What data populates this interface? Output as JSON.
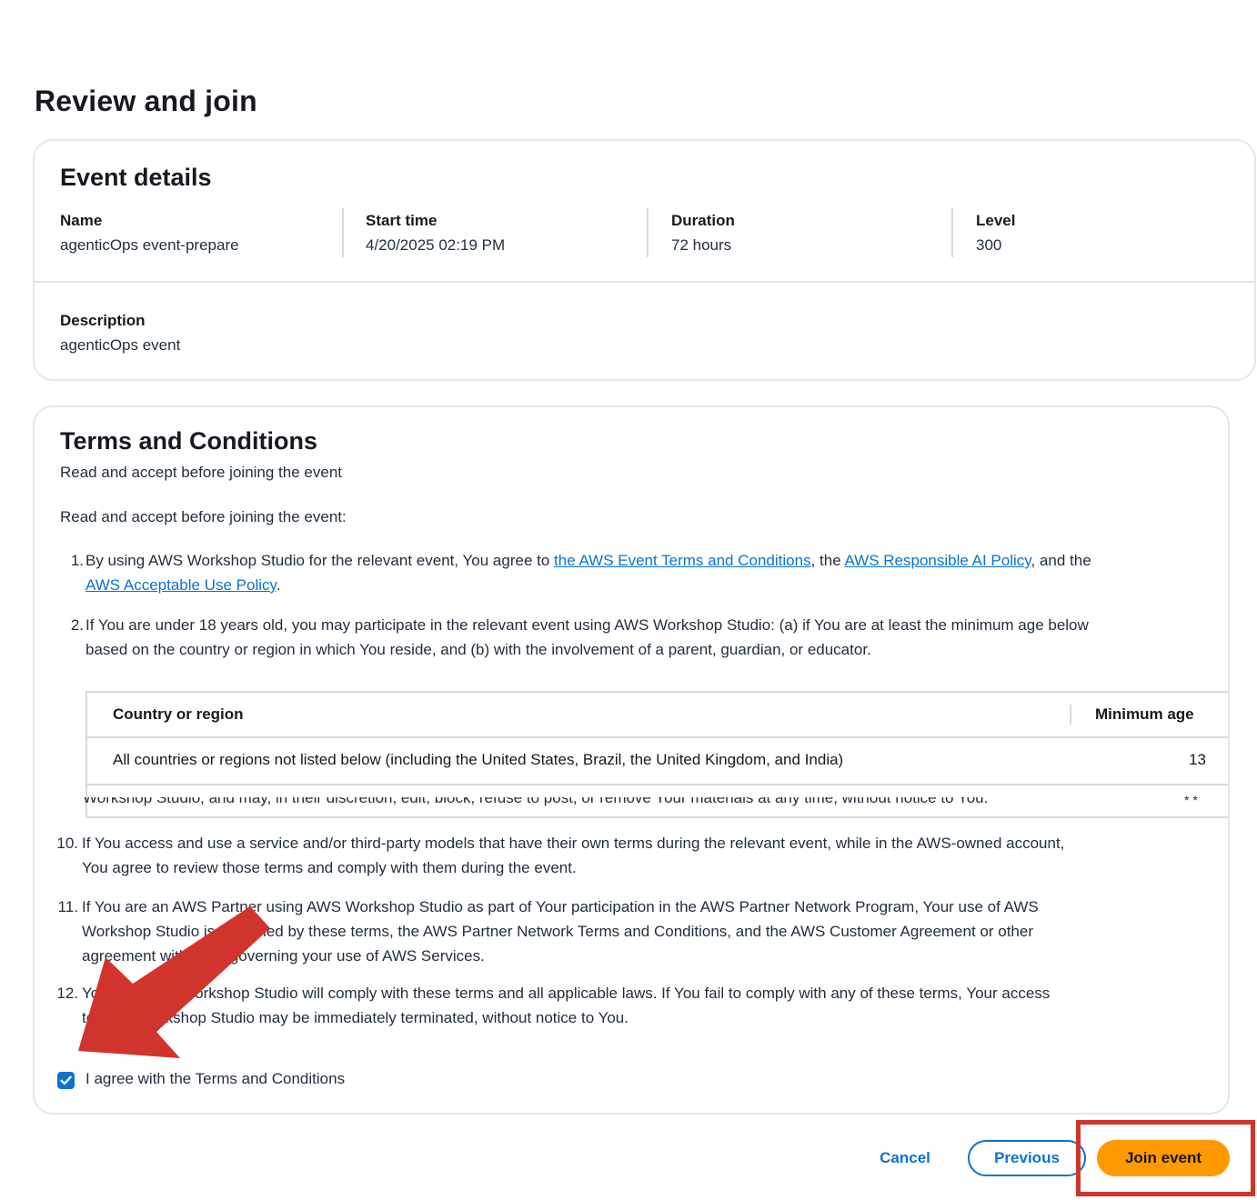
{
  "page": {
    "title": "Review and join"
  },
  "event_details": {
    "title": "Event details",
    "name_label": "Name",
    "name_value": "agenticOps event-prepare",
    "start_label": "Start time",
    "start_value": "4/20/2025 02:19 PM",
    "duration_label": "Duration",
    "duration_value": "72 hours",
    "level_label": "Level",
    "level_value": "300",
    "description_label": "Description",
    "description_value": "agenticOps event"
  },
  "terms": {
    "title": "Terms and Conditions",
    "subtitle": "Read and accept before joining the event",
    "intro": "Read and accept before joining the event:",
    "item1": {
      "number": "1.",
      "text_a": "By using AWS Workshop Studio for the relevant event, You agree to ",
      "link_a": "the AWS Event Terms and Conditions",
      "text_b": ", the ",
      "link_b": "AWS Responsible AI Policy",
      "text_c": ", and the",
      "link_c": "AWS Acceptable Use Policy",
      "text_d": "."
    },
    "item2": {
      "number": "2.",
      "line1": "If You are under 18 years old, you may participate in the relevant event using AWS Workshop Studio: (a) if You are at least the minimum age below",
      "line2": "based on the country or region in which You reside, and (b) with the involvement of a parent, guardian, or educator."
    },
    "age_table": {
      "col_country": "Country or region",
      "col_age": "Minimum age",
      "rows": [
        {
          "country": "All countries or regions not listed below (including the United States, Brazil, the United Kingdom, and India)",
          "age": "13"
        }
      ]
    },
    "clipped_line": "Workshop Studio, and may, in their discretion, edit, block, refuse to post, or remove Your materials at any time, without notice to You.",
    "clipped_right": "* *",
    "item10": {
      "number": "10.",
      "line1": "If You access and use a service and/or third-party models that have their own terms during the relevant event, while in the AWS-owned account,",
      "line2": "You agree to review those terms and comply with them during the event."
    },
    "item11": {
      "number": "11.",
      "line1": "If You are an AWS Partner using AWS Workshop Studio as part of Your participation in the AWS Partner Network Program, Your use of AWS",
      "line2": "Workshop Studio is governed by these terms, the AWS Partner Network Terms and Conditions, and the AWS Customer Agreement or other",
      "line3": "agreement with AWS governing your use of AWS Services."
    },
    "item12": {
      "number": "12.",
      "line1": "You and AWS Workshop Studio will comply with these terms and all applicable laws. If You fail to comply with any of these terms, Your access",
      "line2": "to AWS Workshop Studio may be immediately terminated, without notice to You."
    },
    "checkbox_label": "I agree with the Terms and Conditions",
    "checkbox_checked": true
  },
  "actions": {
    "cancel": "Cancel",
    "previous": "Previous",
    "join": "Join event"
  },
  "colors": {
    "link": "#0972d3",
    "primary_button": "#ff9900",
    "annotation": "#d0342c"
  }
}
